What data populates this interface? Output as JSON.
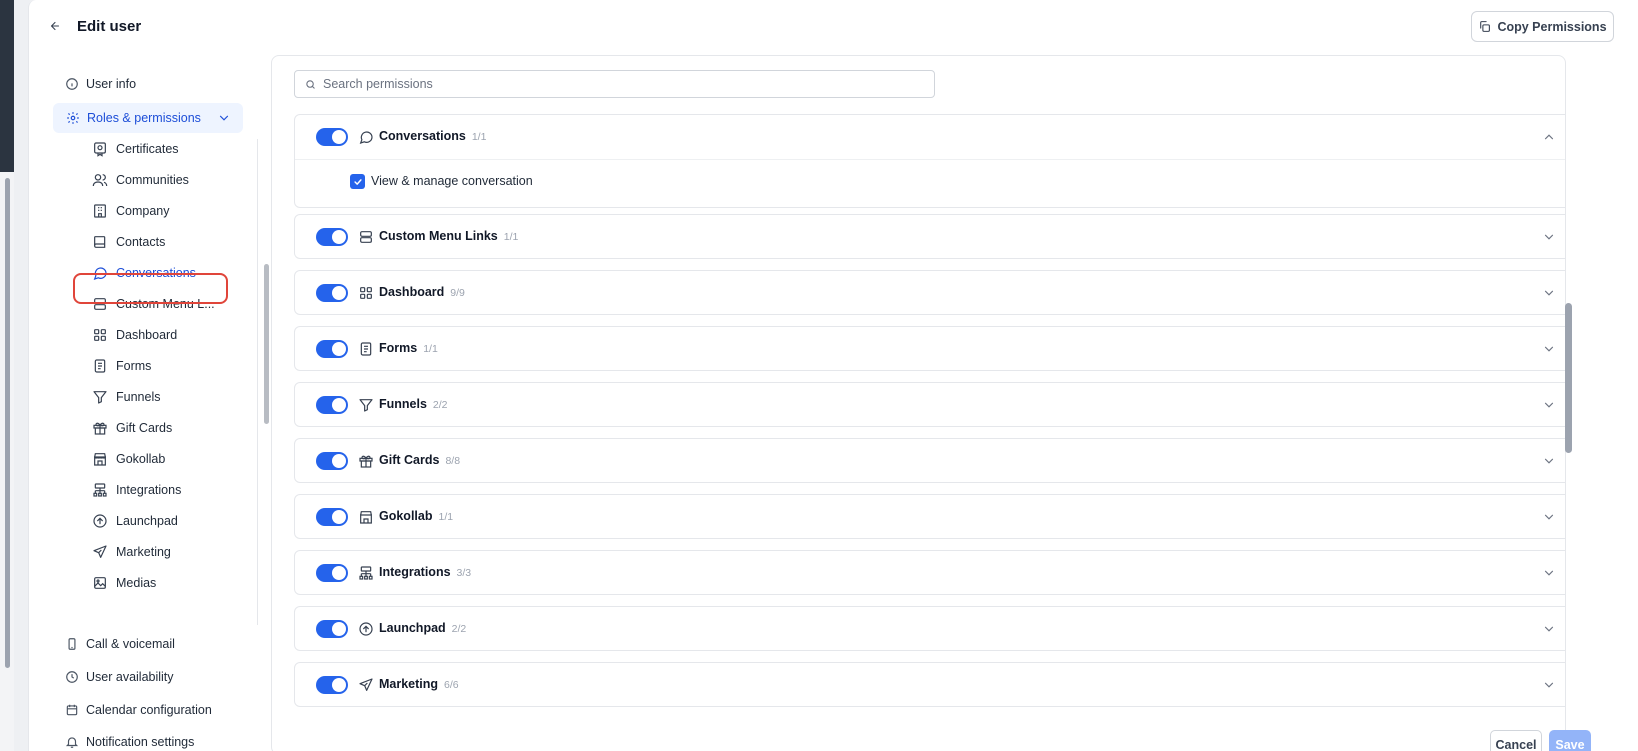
{
  "header": {
    "title": "Edit user",
    "copy_button": "Copy Permissions"
  },
  "sidebar": {
    "items_top": [
      {
        "label": "User info",
        "icon": "info-icon"
      }
    ],
    "roles": {
      "label": "Roles & permissions",
      "icon": "gear-icon",
      "expanded": true
    },
    "sub_items": [
      {
        "label": "Certificates",
        "icon": "certificate-icon"
      },
      {
        "label": "Communities",
        "icon": "users-icon"
      },
      {
        "label": "Company",
        "icon": "building-icon"
      },
      {
        "label": "Contacts",
        "icon": "book-icon"
      },
      {
        "label": "Conversations",
        "icon": "chat-icon",
        "active": true
      },
      {
        "label": "Custom Menu L...",
        "icon": "menu-links-icon"
      },
      {
        "label": "Dashboard",
        "icon": "grid-icon"
      },
      {
        "label": "Forms",
        "icon": "form-icon"
      },
      {
        "label": "Funnels",
        "icon": "funnel-icon"
      },
      {
        "label": "Gift Cards",
        "icon": "gift-icon"
      },
      {
        "label": "Gokollab",
        "icon": "store-icon"
      },
      {
        "label": "Integrations",
        "icon": "sitemap-icon"
      },
      {
        "label": "Launchpad",
        "icon": "arrow-up-circle-icon"
      },
      {
        "label": "Marketing",
        "icon": "send-icon"
      },
      {
        "label": "Medias",
        "icon": "image-icon"
      }
    ],
    "items_bottom": [
      {
        "label": "Call & voicemail",
        "icon": "phone-icon"
      },
      {
        "label": "User availability",
        "icon": "clock-icon"
      },
      {
        "label": "Calendar configuration",
        "icon": "calendar-icon"
      },
      {
        "label": "Notification settings",
        "icon": "bell-icon"
      }
    ]
  },
  "search": {
    "placeholder": "Search permissions",
    "value": ""
  },
  "permissions": [
    {
      "label": "Conversations",
      "count": "1/1",
      "icon": "chat-icon",
      "enabled": true,
      "expanded": true,
      "children": [
        {
          "label": "View & manage conversation",
          "checked": true
        }
      ]
    },
    {
      "label": "Custom Menu Links",
      "count": "1/1",
      "icon": "menu-links-icon",
      "enabled": true,
      "expanded": false
    },
    {
      "label": "Dashboard",
      "count": "9/9",
      "icon": "grid-icon",
      "enabled": true,
      "expanded": false
    },
    {
      "label": "Forms",
      "count": "1/1",
      "icon": "form-icon",
      "enabled": true,
      "expanded": false
    },
    {
      "label": "Funnels",
      "count": "2/2",
      "icon": "funnel-icon",
      "enabled": true,
      "expanded": false
    },
    {
      "label": "Gift Cards",
      "count": "8/8",
      "icon": "gift-icon",
      "enabled": true,
      "expanded": false
    },
    {
      "label": "Gokollab",
      "count": "1/1",
      "icon": "store-icon",
      "enabled": true,
      "expanded": false
    },
    {
      "label": "Integrations",
      "count": "3/3",
      "icon": "sitemap-icon",
      "enabled": true,
      "expanded": false
    },
    {
      "label": "Launchpad",
      "count": "2/2",
      "icon": "arrow-up-circle-icon",
      "enabled": true,
      "expanded": false
    },
    {
      "label": "Marketing",
      "count": "6/6",
      "icon": "send-icon",
      "enabled": true,
      "expanded": false
    }
  ],
  "footer": {
    "cancel": "Cancel",
    "save": "Save"
  },
  "colors": {
    "accent": "#2563eb",
    "highlight": "#e0453a",
    "save_disabled": "#93b4f8"
  }
}
